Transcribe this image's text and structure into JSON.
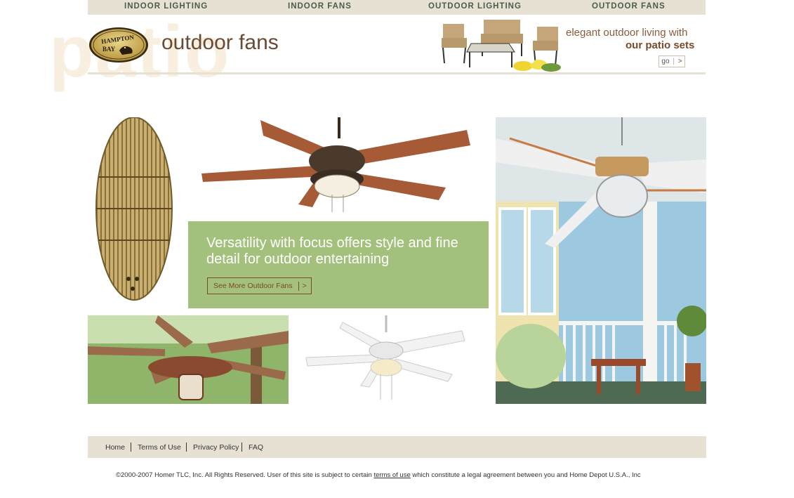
{
  "nav": {
    "items": [
      "INDOOR LIGHTING",
      "INDOOR FANS",
      "OUTDOOR LIGHTING",
      "OUTDOOR FANS"
    ]
  },
  "header": {
    "watermark": "patio",
    "logo_text": {
      "line1": "HAMPTON",
      "line2": "BAY"
    },
    "title": "outdoor fans",
    "promo": {
      "line1": "elegant outdoor living with",
      "line2": "our patio sets",
      "go_label": "go",
      "go_arrow": ">"
    }
  },
  "main": {
    "promo_text": "Versatility with focus offers style and fine detail for outdoor entertaining",
    "cta_label": "See More Outdoor Fans",
    "cta_arrow": ">"
  },
  "footer": {
    "links": [
      "Home",
      "Terms of Use",
      "Privacy Policy",
      "FAQ"
    ],
    "copyright_pre": "©2000-2007 Homer TLC, Inc. All Rights Reserved. User of this site is subject to certain ",
    "copyright_link": "terms of use",
    "copyright_post": " which constitute a legal agreement between you and Home Depot U.S.A., Inc"
  },
  "colors": {
    "nav_bg": "#e6e1d3",
    "nav_text": "#4a5e4c",
    "title_brown": "#6b4a34",
    "promo_green": "#a3c07c",
    "watermark": "#f8efe0"
  },
  "icons": {
    "go_arrow": "chevron-right-icon",
    "cta_arrow": "chevron-right-icon"
  }
}
